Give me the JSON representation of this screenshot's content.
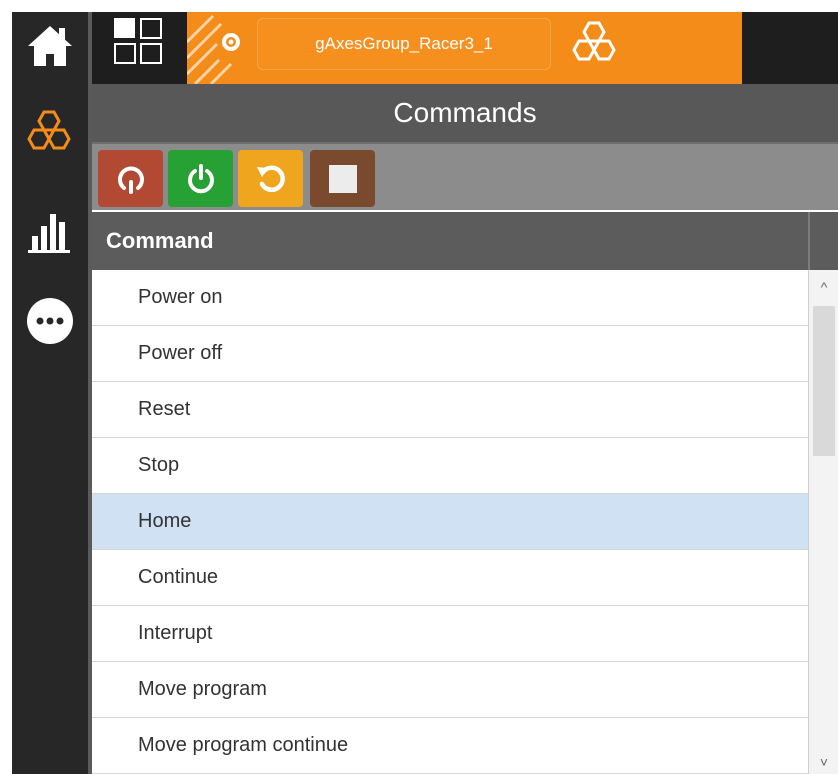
{
  "colors": {
    "accent_orange": "#f48c1a",
    "nav_bg": "#272727",
    "header_gray": "#585858",
    "selected_row": "#cfe1f3",
    "btn_restart": "#b24a33",
    "btn_power": "#27a034",
    "btn_reset": "#f0a51e",
    "btn_stop": "#7a4a2e"
  },
  "nav": {
    "items": [
      {
        "icon": "home-icon"
      },
      {
        "icon": "hexagon-cluster-icon"
      },
      {
        "icon": "bar-chart-icon"
      },
      {
        "icon": "more-icon"
      }
    ]
  },
  "topbar": {
    "tab_title": "gAxesGroup_Racer3_1"
  },
  "panel": {
    "title": "Commands"
  },
  "toolbar": {
    "buttons": [
      {
        "icon": "restart-icon"
      },
      {
        "icon": "power-icon"
      },
      {
        "icon": "reset-icon"
      },
      {
        "icon": "stop-icon"
      }
    ]
  },
  "table": {
    "column": "Command",
    "rows": [
      "Power on",
      "Power off",
      "Reset",
      "Stop",
      "Home",
      "Continue",
      "Interrupt",
      "Move program",
      "Move program continue"
    ],
    "selected_index": 4
  },
  "scrollbar": {
    "up": "^",
    "down": "˅"
  }
}
